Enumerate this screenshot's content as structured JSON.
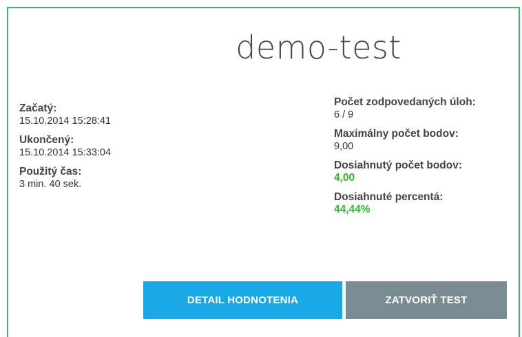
{
  "test": {
    "title": "demo-test"
  },
  "left": {
    "started_label": "Začatý:",
    "started_value": "15.10.2014 15:28:41",
    "ended_label": "Ukončený:",
    "ended_value": "15.10.2014 15:33:04",
    "time_label": "Použitý čas:",
    "time_value": "3 min. 40 sek."
  },
  "right": {
    "answered_label": "Počet zodpovedaných úloh:",
    "answered_value": "6 / 9",
    "max_points_label": "Maximálny počet bodov:",
    "max_points_value": "9,00",
    "achieved_points_label": "Dosiahnutý počet bodov:",
    "achieved_points_value": "4,00",
    "percent_label": "Dosiahnuté percentá:",
    "percent_value": "44,44%"
  },
  "buttons": {
    "detail_label": "DETAIL HODNOTENIA",
    "close_label": "ZATVORIŤ TEST"
  },
  "colors": {
    "border": "#3cb65a",
    "success": "#2fb52f",
    "primary_button": "#1aa9e6",
    "secondary_button": "#7a8b94"
  }
}
